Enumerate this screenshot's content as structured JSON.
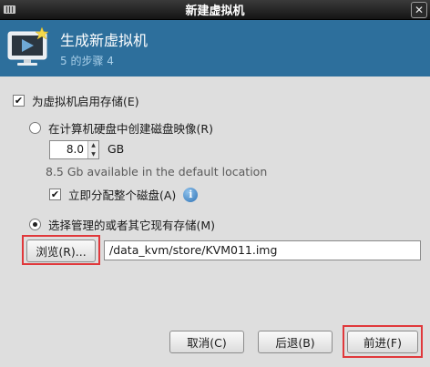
{
  "window": {
    "title": "新建虚拟机"
  },
  "header": {
    "title": "生成新虚拟机",
    "step": "5 的步骤 4"
  },
  "storage": {
    "enable_label": "为虚拟机启用存储(E)",
    "enable_checked": true,
    "create_label": "在计算机硬盘中创建磁盘映像(R)",
    "create_selected": false,
    "size_value": "8.0",
    "size_unit": "GB",
    "available": "8.5 Gb available in the default location",
    "allocate_label": "立即分配整个磁盘(A)",
    "allocate_checked": true,
    "existing_label": "选择管理的或者其它现有存储(M)",
    "existing_selected": true,
    "browse_label": "浏览(R)...",
    "path_value": "/data_kvm/store/KVM011.img"
  },
  "buttons": {
    "cancel": "取消(C)",
    "back": "后退(B)",
    "forward": "前进(F)"
  },
  "colors": {
    "header_bg": "#2d6f9c",
    "highlight": "#e0383b",
    "dialog_bg": "#dedede"
  },
  "icons": {
    "info": "info-icon",
    "vm": "virtual-machine-icon"
  }
}
